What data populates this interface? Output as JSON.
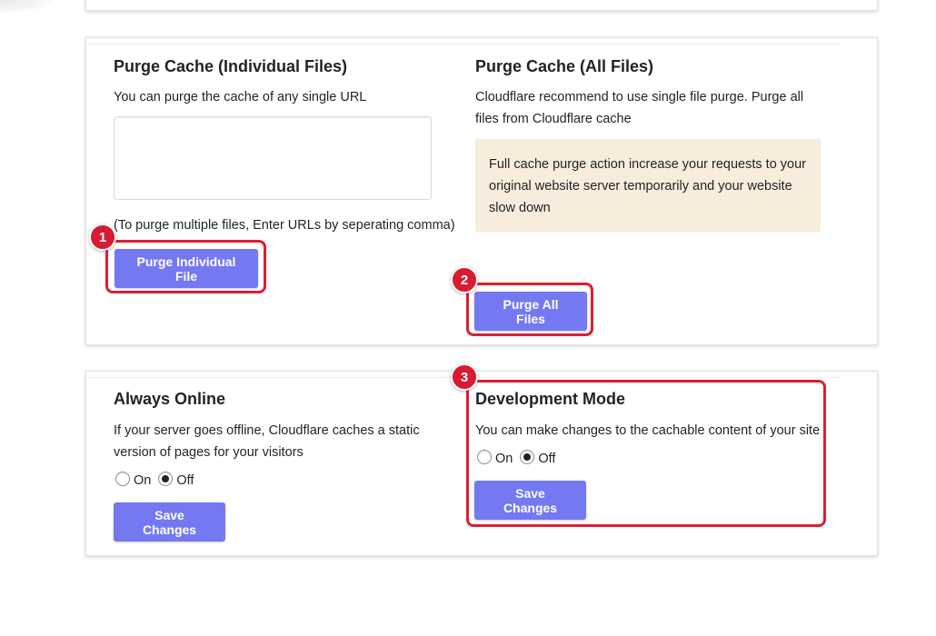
{
  "purge_individual": {
    "title": "Purge Cache (Individual Files)",
    "description": "You can purge the cache of any single URL",
    "textarea_value": "",
    "hint": "(To purge multiple files, Enter URLs by seperating comma)",
    "button_label": "Purge Individual File"
  },
  "purge_all": {
    "title": "Purge Cache (All Files)",
    "description": "Cloudflare recommend to use single file purge. Purge all files from Cloudflare cache",
    "notice": "Full cache purge action increase your requests to your original website server temporarily and your website slow down",
    "button_label": "Purge All Files"
  },
  "always_online": {
    "title": "Always Online",
    "description": "If your server goes offline, Cloudflare caches a static version of pages for your visitors",
    "options": [
      "On",
      "Off"
    ],
    "selected": "Off",
    "button_label": "Save Changes"
  },
  "development_mode": {
    "title": "Development Mode",
    "description": "You can make changes to the cachable content of your site",
    "options": [
      "On",
      "Off"
    ],
    "selected": "Off",
    "button_label": "Save Changes"
  },
  "annotations": {
    "badge_1": "1",
    "badge_2": "2",
    "badge_3": "3",
    "highlight_color": "#dc1e35"
  },
  "colors": {
    "button_bg": "#7479f2",
    "notice_bg": "#f8ecdc"
  }
}
